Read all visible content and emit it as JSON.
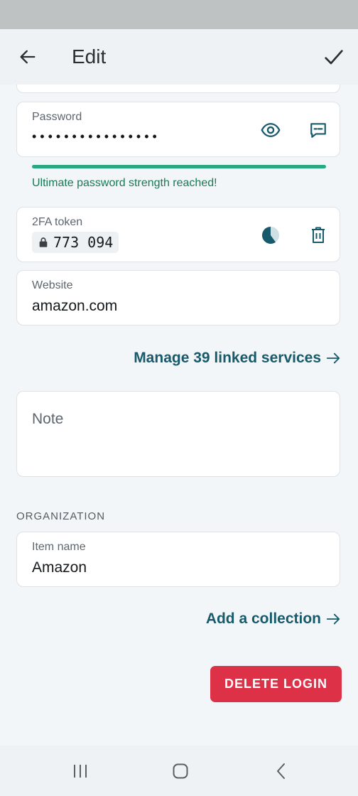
{
  "app_bar": {
    "title": "Edit"
  },
  "password_field": {
    "label": "Password",
    "value": "••••••••••••••••",
    "strength_fraction": 1.0,
    "strength_message": "Ultimate password strength reached!"
  },
  "totp_field": {
    "label": "2FA token",
    "code": "773 094",
    "timer_remaining_fraction": 0.6
  },
  "website_field": {
    "label": "Website",
    "value": "amazon.com"
  },
  "linked_services": {
    "label": "Manage 39 linked services"
  },
  "note_field": {
    "placeholder": "Note"
  },
  "organization": {
    "section_title": "ORGANIZATION",
    "item_name_label": "Item name",
    "item_name_value": "Amazon",
    "add_collection_label": "Add a collection"
  },
  "actions": {
    "delete_label": "DELETE LOGIN"
  },
  "icons": {
    "back": "arrow-left-icon",
    "save": "check-icon",
    "reveal": "eye-icon",
    "generate": "password-generator-icon",
    "timer": "countdown-pie-icon",
    "remove": "trash-icon",
    "lock": "lock-icon",
    "arrow": "arrow-right-icon"
  },
  "colors": {
    "accent": "#175a6b",
    "strength": "#2aa880",
    "danger": "#dd3148"
  }
}
